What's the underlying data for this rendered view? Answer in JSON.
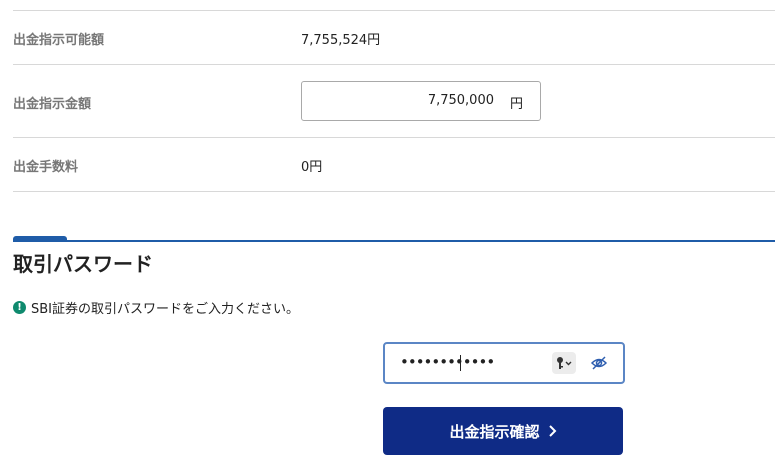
{
  "rows": [
    {
      "label": "出金指示可能額",
      "value": "7,755,524円"
    },
    {
      "label": "出金指示金額",
      "value": "7,750,000",
      "unit": "円"
    },
    {
      "label": "出金手数料",
      "value": "0円"
    }
  ],
  "password_section": {
    "title": "取引パスワード",
    "notice": "SBI証券の取引パスワードをご入力ください。",
    "notice_icon_glyph": "!",
    "password_value": "••••••••••••",
    "key_icon": "key-icon",
    "visibility_icon": "eye-slash-icon"
  },
  "confirm_button": {
    "label": "出金指示確認",
    "icon": "chevron-right-icon"
  },
  "colors": {
    "accent_blue": "#1f5ca8",
    "button_navy": "#0f2b86",
    "notice_green": "#0f8a6e",
    "focus_border": "#5b86c5"
  }
}
